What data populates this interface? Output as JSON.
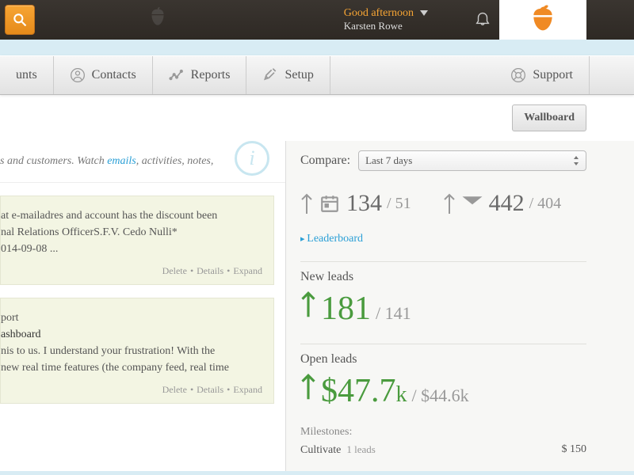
{
  "topbar": {
    "greeting": "Good afternoon",
    "username": "Karsten Rowe"
  },
  "nav": {
    "accounts": "unts",
    "contacts": "Contacts",
    "reports": "Reports",
    "setup": "Setup",
    "support": "Support"
  },
  "wallboard_btn": "Wallboard",
  "intro": {
    "prefix": "s and customers. Watch ",
    "link": "emails",
    "suffix": ", activities, notes,"
  },
  "card1": {
    "line1": "at e-mailadres and account has the discount been",
    "line2": "nal Relations OfficerS.F.V. Cedo Nulli*",
    "line3": "014-09-08 ..."
  },
  "card2": {
    "line1": "port",
    "line2": "ashboard",
    "line3": "nis to us. I understand your frustration! With the",
    "line4": "new real time features (the company feed, real time"
  },
  "card_links": {
    "delete": "Delete",
    "details": "Details",
    "expand": "Expand"
  },
  "compare": {
    "label": "Compare:",
    "value": "Last 7 days"
  },
  "stat1": {
    "val": "134",
    "prev": "51"
  },
  "stat2": {
    "val": "442",
    "prev": "404"
  },
  "leaderboard": "Leaderboard",
  "new_leads": {
    "label": "New leads",
    "val": "181",
    "prev": "141"
  },
  "open_leads": {
    "label": "Open leads",
    "val": "$47.7",
    "unit": "k",
    "prev": "$44.6k"
  },
  "milestones": {
    "label": "Milestones:",
    "row1_name": "Cultivate",
    "row1_count": "1 leads",
    "row1_val": "$ 150"
  }
}
